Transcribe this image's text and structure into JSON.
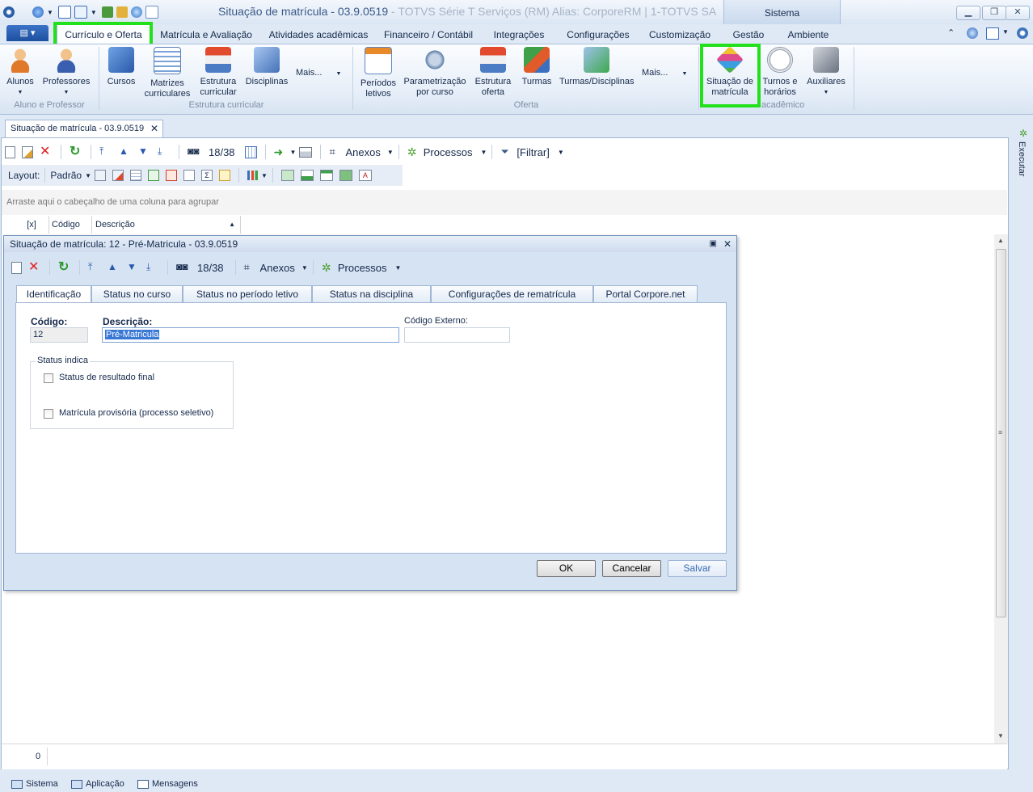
{
  "window": {
    "title": "Situação de matrícula - 03.9.0519",
    "title_suffix": " - TOTVS Série T Serviços (RM) Alias: CorporeRM | 1-TOTVS SA",
    "context_tab": "Sistema"
  },
  "menu": {
    "tabs": [
      "Currículo e Oferta",
      "Matrícula e Avaliação",
      "Atividades acadêmicas",
      "Financeiro / Contábil",
      "Integrações",
      "Configurações",
      "Customização",
      "Gestão",
      "Ambiente"
    ]
  },
  "ribbon": {
    "aluno_professor": {
      "label": "Aluno e Professor",
      "alunos": "Alunos",
      "professores": "Professores"
    },
    "estrutura": {
      "label": "Estrutura curricular",
      "cursos": "Cursos",
      "matrizes_1": "Matrizes",
      "matrizes_2": "curriculares",
      "estrutura_1": "Estrutura",
      "estrutura_2": "curricular",
      "disciplinas": "Disciplinas",
      "mais": "Mais..."
    },
    "oferta": {
      "label": "Oferta",
      "periodos_1": "Períodos",
      "periodos_2": "letivos",
      "param_1": "Parametrização",
      "param_2": "por curso",
      "estoferta_1": "Estrutura",
      "estoferta_2": "oferta",
      "turmas": "Turmas",
      "turmas_disc": "Turmas/Disciplinas",
      "mais": "Mais..."
    },
    "academico": {
      "label": "acadêmico",
      "situacao_1": "Situação de",
      "situacao_2": "matrícula",
      "turnos_1": "Turnos e",
      "turnos_2": "horários",
      "auxiliares": "Auxiliares"
    }
  },
  "doc_tab": {
    "label": "Situação de matrícula - 03.9.0519"
  },
  "toolbar": {
    "counter": "18/38",
    "anexos": "Anexos",
    "processos": "Processos",
    "filtrar": "[Filtrar]"
  },
  "layout_bar": {
    "layout": "Layout:",
    "padrao": "Padrão"
  },
  "grid": {
    "group_hint": "Arraste aqui o cabeçalho de uma coluna para agrupar",
    "columns": [
      "[x]",
      "Código",
      "Descrição"
    ],
    "footer_count": "0"
  },
  "side_panel": {
    "executar": "Executar"
  },
  "statusbar": {
    "items": [
      "Sistema",
      "Aplicação",
      "Mensagens"
    ]
  },
  "dialog": {
    "title": "Situação de matrícula: 12 - Pré-Matricula - 03.9.0519",
    "counter": "18/38",
    "anexos": "Anexos",
    "processos": "Processos",
    "tabs": [
      "Identificação",
      "Status no curso",
      "Status no período letivo",
      "Status na disciplina",
      "Configurações de rematrícula",
      "Portal Corpore.net"
    ],
    "fields": {
      "codigo_label": "Código:",
      "codigo_value": "12",
      "descricao_label": "Descrição:",
      "descricao_value": "Pré-Matricula",
      "codigo_externo_label": "Código Externo:",
      "codigo_externo_value": ""
    },
    "status_group": {
      "legend": "Status indica",
      "checkbox_1": "Status de resultado final",
      "checkbox_2": "Matrícula provisória (processo seletivo)"
    },
    "buttons": {
      "ok": "OK",
      "cancel": "Cancelar",
      "save": "Salvar"
    }
  },
  "colors": {
    "highlight": "#22e01c",
    "accent": "#1d4f9e"
  }
}
